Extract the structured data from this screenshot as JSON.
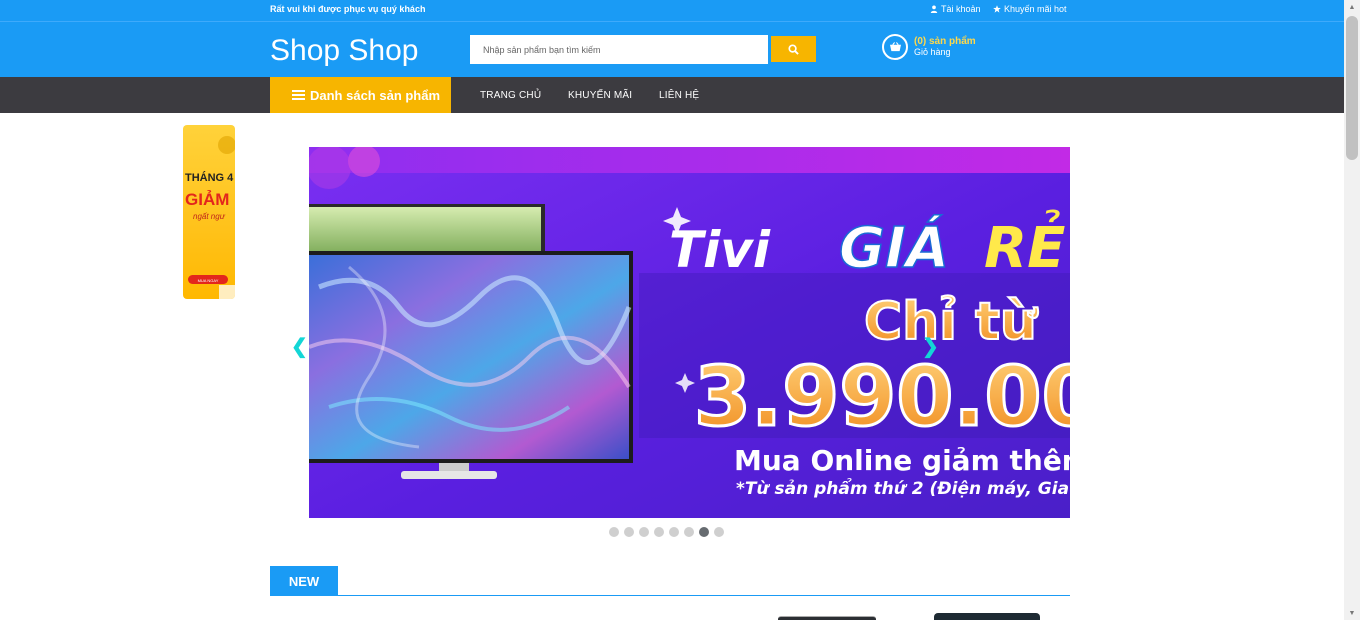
{
  "topbar": {
    "welcome": "Rất vui khi được phục vụ quý khách",
    "account_link": "Tài khoản",
    "promo_link": "Khuyến mãi hot"
  },
  "header": {
    "logo": "Shop Shop",
    "search_placeholder": "Nhập sản phẩm bạn tìm kiếm",
    "cart_count": "(0) sản phẩm",
    "cart_label": "Giỏ hàng"
  },
  "nav": {
    "categories_label": "Danh sách sản phẩm",
    "items": [
      "TRANG CHỦ",
      "KHUYẾN MÃI",
      "LIÊN HỆ"
    ]
  },
  "side_ad": {
    "line1": "THÁNG 4",
    "line2": "GIẢM",
    "line3": "ngất ngư",
    "button": "MUA NGAY"
  },
  "slider": {
    "headline_1": "Tivi",
    "headline_2": "GIÁ",
    "headline_3": "RẺ",
    "price_prefix": "Chỉ từ",
    "price": "3.990.00",
    "sub_1": "Mua Online giảm thêm",
    "sub_2": "*Từ sản phẩm thứ 2 (Điện máy, Gia",
    "prev": "❮",
    "next": "❯",
    "dot_count": 8,
    "active_dot": 7
  },
  "section": {
    "new_label": "NEW"
  },
  "colors": {
    "primary": "#1a9bf5",
    "accent": "#f7b500",
    "nav_bg": "#3c3b40"
  }
}
